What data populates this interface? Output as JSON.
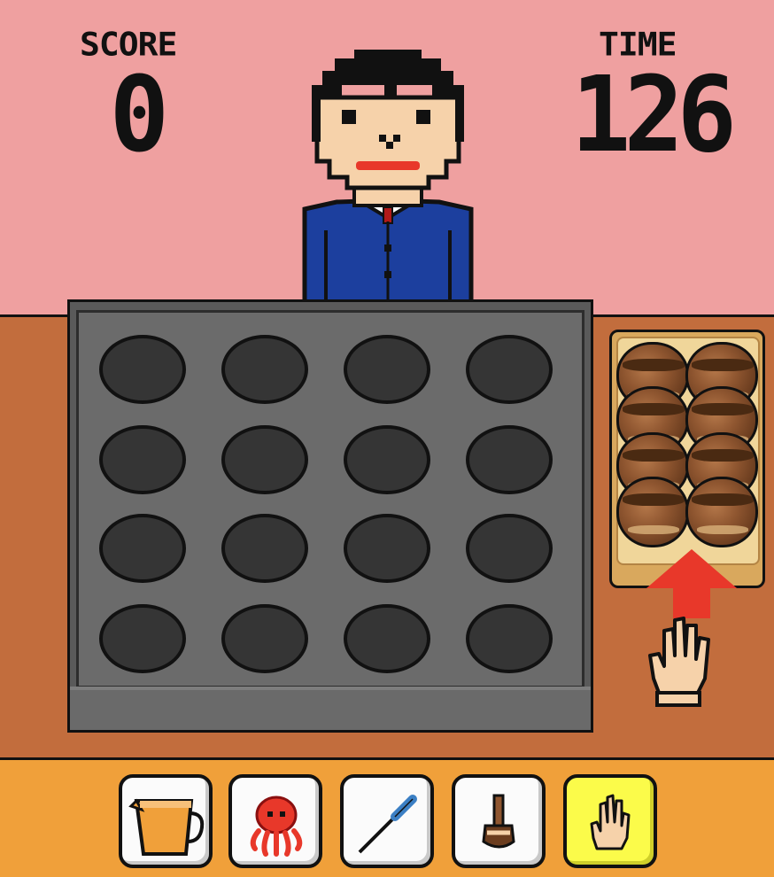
{
  "hud": {
    "score_label": "SCORE",
    "score_value": "0",
    "time_label": "TIME",
    "time_value": "126"
  },
  "colors": {
    "wall": "#efa0a0",
    "counter": "#c26d3d",
    "toolbar": "#f0a03a",
    "griddle": "#5a5a5a",
    "hole": "#353535",
    "selected_tool": "#fbfb4a",
    "arrow": "#e8382a"
  },
  "griddle": {
    "rows": 4,
    "cols": 4,
    "holes_state": "empty"
  },
  "tray": {
    "takoyaki_count": 8,
    "rows": 4,
    "cols": 2
  },
  "hint": {
    "arrow": "up-arrow-icon",
    "hand": "hand-icon"
  },
  "tools": [
    {
      "name": "batter-pitcher",
      "icon": "pitcher-icon",
      "selected": false
    },
    {
      "name": "octopus",
      "icon": "octopus-icon",
      "selected": false
    },
    {
      "name": "pick",
      "icon": "pick-icon",
      "selected": false
    },
    {
      "name": "sauce-brush",
      "icon": "sauce-brush-icon",
      "selected": false
    },
    {
      "name": "hand",
      "icon": "hand-icon",
      "selected": true
    }
  ]
}
